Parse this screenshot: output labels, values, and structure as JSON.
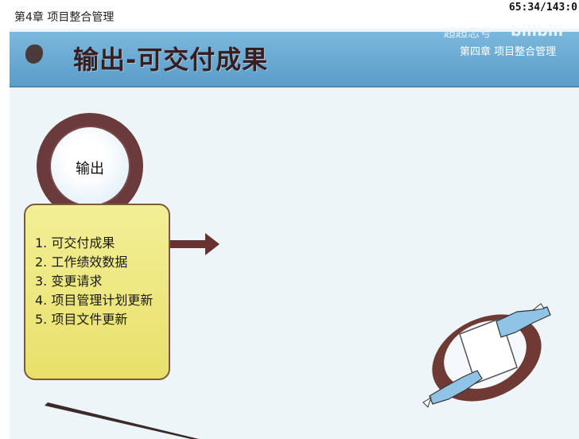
{
  "chapter_label": "第4章 项目整合管理",
  "timer": "65:34/143:0",
  "header": {
    "title": "输出-可交付成果",
    "chapter_right": "第四章 项目整合管理",
    "watermark_text": "超超恋号",
    "watermark_logo": "bilibili"
  },
  "circle_label": "输出",
  "outputs": [
    "1. 可交付成果",
    "2. 工作绩效数据",
    "3. 变更请求",
    "4. 项目管理计划更新",
    "5. 项目文件更新"
  ],
  "colors": {
    "header_blue": "#6aaad3",
    "brown": "#6b3a3a",
    "box_yellow": "#efe882",
    "slide_bg": "#eef5f8"
  },
  "icons": [
    "arrow-right-icon",
    "handshake-document-icon",
    "bullet-blob-icon"
  ]
}
